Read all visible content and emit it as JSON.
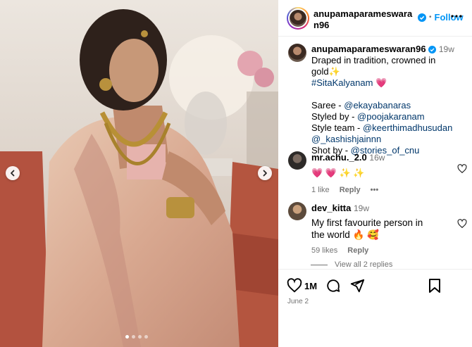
{
  "post": {
    "username": "anupamaparameswaran96",
    "follow_label": "Follow",
    "separator": "•",
    "caption": {
      "time": "19w",
      "line1": "Draped in tradition, crowned in gold",
      "line1_emoji": "✨",
      "hashtag": "#SitaKalyanam",
      "hashtag_emoji": "💗",
      "credits": [
        {
          "label": "Saree - ",
          "handle": "@ekayabanaras"
        },
        {
          "label": "Styled by - ",
          "handle": "@poojakaranam"
        },
        {
          "label": "Style team - ",
          "handle": "@keerthimadhusudan"
        },
        {
          "label": "",
          "handle": "@_kashishjainnn"
        },
        {
          "label": "Shot by - ",
          "handle": "@stories_of_cnu"
        }
      ]
    },
    "comments": [
      {
        "username": "mr.achu._2.0",
        "time": "16w",
        "text": "💗 💗 ✨ ✨",
        "likes": "1 like",
        "reply": "Reply",
        "more": "•••"
      },
      {
        "username": "dev_kitta",
        "time": "19w",
        "text": "My first favourite person in the world 🔥 🥰",
        "likes": "59 likes",
        "reply": "Reply"
      }
    ],
    "view_replies": "View all 2 replies",
    "like_count": "1M",
    "date": "June 2",
    "carousel": {
      "slides": 4,
      "active": 0
    }
  },
  "colors": {
    "accent": "#0095f6",
    "link": "#00376b",
    "muted": "#737373"
  },
  "icons": [
    "heart-icon",
    "comment-icon",
    "share-icon",
    "bookmark-icon",
    "more-icon",
    "verified-icon",
    "chevron-left-icon",
    "chevron-right-icon"
  ]
}
